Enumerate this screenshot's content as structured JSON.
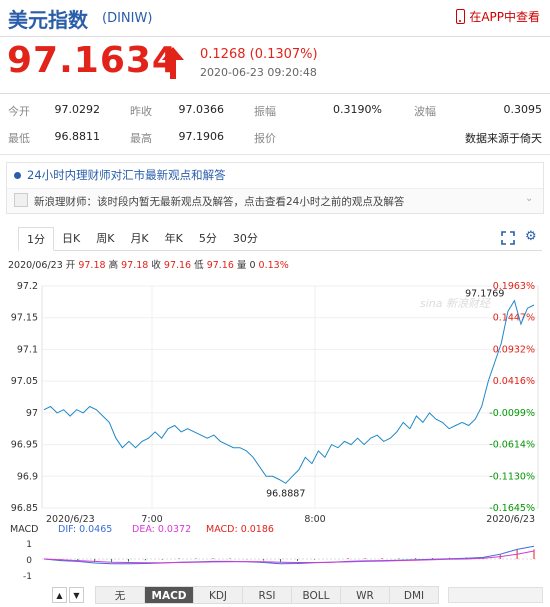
{
  "header": {
    "title": "美元指数",
    "code": "(DINIW)",
    "app_link": "在APP中查看"
  },
  "quote": {
    "price": "97.1634",
    "change": "0.1268 (0.1307%)",
    "datetime": "2020-06-23 09:20:48"
  },
  "stats": {
    "row1": [
      {
        "label": "今开",
        "value": "97.0292"
      },
      {
        "label": "昨收",
        "value": "97.0366"
      },
      {
        "label": "振幅",
        "value": "0.3190%"
      },
      {
        "label": "波幅",
        "value": "0.3095"
      }
    ],
    "row2": [
      {
        "label": "最低",
        "value": "96.8811"
      },
      {
        "label": "最高",
        "value": "97.1906"
      },
      {
        "label": "报价",
        "value": "数据来源于倚天"
      }
    ]
  },
  "advisor": {
    "title": "24小时内理财师对汇市最新观点和解答",
    "message": "新浪理财师：该时段内暂无最新观点及解答，点击查看24小时之前的观点及解答"
  },
  "chart_tabs": [
    "1分",
    "日K",
    "周K",
    "月K",
    "年K",
    "5分",
    "30分"
  ],
  "active_chart_tab": "1分",
  "ohlc": {
    "date": "2020/06/23",
    "open_label": "开",
    "open": "97.18",
    "high_label": "高",
    "high": "97.18",
    "close_label": "收",
    "close": "97.16",
    "low_label": "低",
    "low": "97.16",
    "volume_label": "量",
    "volume": "0",
    "change_pct": "0.13%"
  },
  "watermark": "sina 新浪财经",
  "indicator": {
    "name": "MACD",
    "dif_label": "DIF: 0.0465",
    "dea_label": "DEA: 0.0372",
    "macd_label": "MACD: 0.0186",
    "axis_labels": [
      "1",
      "0",
      "-1"
    ]
  },
  "indicator_tabs": [
    "无",
    "MACD",
    "KDJ",
    "RSI",
    "BOLL",
    "WR",
    "DMI"
  ],
  "active_indicator_tab": "MACD",
  "nav": {
    "prev": "▲",
    "next": "▼"
  },
  "colors": {
    "brand_blue": "#2a5daa",
    "up_red": "#e2231a",
    "down_green": "#009900",
    "line": "#1e88c8",
    "dif": "#3a6fd8",
    "dea": "#d63ad6"
  },
  "chart_data": {
    "type": "line",
    "y_ticks": [
      "97.2",
      "97.15",
      "97.1",
      "97.05",
      "97",
      "96.95",
      "96.9",
      "96.85"
    ],
    "pct_ticks": [
      "0.1963%",
      "0.1447%",
      "0.0932%",
      "0.0416%",
      "-0.0099%",
      "-0.0614%",
      "-0.1130%",
      "-0.1645%"
    ],
    "x_ticks": [
      "2020/6/23",
      "7:00",
      "8:00",
      "2020/6/23"
    ],
    "ylim": [
      96.85,
      97.2
    ],
    "max_label": "97.1769",
    "min_label": "96.8887",
    "series": [
      {
        "values": [
          97.005,
          97.01,
          97.0,
          97.005,
          96.995,
          97.005,
          97.0,
          97.01,
          97.005,
          96.995,
          96.985,
          96.96,
          96.945,
          96.955,
          96.945,
          96.955,
          96.96,
          96.97,
          96.96,
          96.975,
          96.98,
          96.97,
          96.975,
          96.97,
          96.965,
          96.96,
          96.965,
          96.955,
          96.95,
          96.945,
          96.945,
          96.94,
          96.93,
          96.915,
          96.9,
          96.9,
          96.895,
          96.889,
          96.9,
          96.91,
          96.93,
          96.92,
          96.94,
          96.93,
          96.95,
          96.945,
          96.955,
          96.95,
          96.96,
          96.95,
          96.96,
          96.965,
          96.955,
          96.96,
          96.97,
          96.985,
          96.975,
          96.995,
          96.985,
          97.0,
          96.99,
          96.985,
          96.975,
          96.98,
          96.985,
          96.98,
          96.99,
          97.01,
          97.05,
          97.08,
          97.11,
          97.16,
          97.177,
          97.14,
          97.165,
          97.17
        ]
      }
    ],
    "macd": {
      "dif": [
        0.0,
        -0.1,
        -0.15,
        -0.25,
        -0.3,
        -0.3,
        -0.28,
        -0.25,
        -0.2,
        -0.18,
        -0.15,
        -0.15,
        -0.17,
        -0.22,
        -0.3,
        -0.28,
        -0.24,
        -0.2,
        -0.15,
        -0.12,
        -0.1,
        -0.08,
        -0.05,
        -0.02,
        0.02,
        0.05,
        0.1,
        0.3,
        0.6,
        0.8
      ],
      "dea": [
        0.0,
        -0.05,
        -0.1,
        -0.15,
        -0.2,
        -0.22,
        -0.24,
        -0.23,
        -0.22,
        -0.2,
        -0.18,
        -0.17,
        -0.16,
        -0.17,
        -0.2,
        -0.22,
        -0.22,
        -0.2,
        -0.18,
        -0.15,
        -0.13,
        -0.1,
        -0.08,
        -0.05,
        -0.02,
        0.0,
        0.05,
        0.15,
        0.3,
        0.5
      ]
    }
  }
}
